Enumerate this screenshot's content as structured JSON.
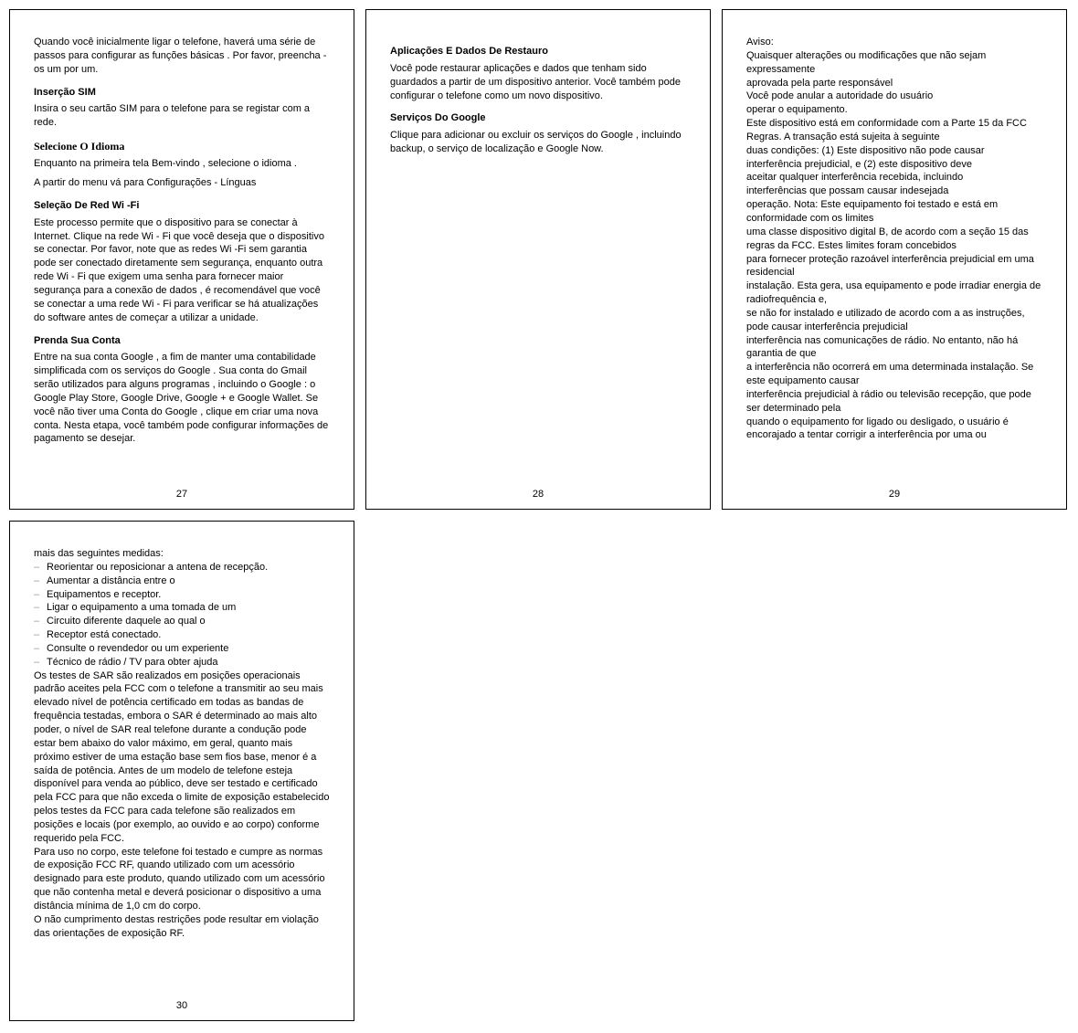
{
  "pages": [
    {
      "number": "27",
      "blocks": [
        {
          "type": "para",
          "text": "Quando você inicialmente ligar o telefone, haverá uma série de passos para configurar as funções básicas . Por favor, preencha -os um por um."
        },
        {
          "type": "heading",
          "text": "Inserção SIM"
        },
        {
          "type": "para",
          "text": "Insira o seu cartão SIM para o telefone para se registar com a rede."
        },
        {
          "type": "heading-serif",
          "text": "Selecione O Idioma"
        },
        {
          "type": "para",
          "text": "Enquanto na primeira tela Bem-vindo , selecione o idioma ."
        },
        {
          "type": "para-tight",
          "text": "A partir do menu vá para Configurações - Línguas"
        },
        {
          "type": "heading",
          "text": "Seleção De Red Wi -Fi"
        },
        {
          "type": "para",
          "text": "Este processo permite que o dispositivo para se conectar à Internet. Clique na rede Wi - Fi que você deseja que o dispositivo se conectar. Por favor, note que as redes Wi -Fi sem garantia pode ser conectado diretamente sem segurança, enquanto outra rede Wi - Fi que exigem uma senha para fornecer maior segurança para a conexão de dados , é recomendável que você se conectar a uma rede Wi - Fi para verificar se há atualizações do software antes de começar a utilizar a unidade."
        },
        {
          "type": "heading",
          "text": "Prenda Sua Conta"
        },
        {
          "type": "para",
          "text": "Entre na sua conta Google , a fim de manter uma contabilidade simplificada com os serviços do Google . Sua conta do Gmail serão utilizados para alguns programas , incluindo o Google : o Google Play Store, Google Drive, Google + e Google Wallet. Se você não tiver uma Conta do Google , clique em criar uma nova conta. Nesta etapa, você também pode configurar informações de pagamento se desejar."
        }
      ]
    },
    {
      "number": "28",
      "blocks": [
        {
          "type": "heading",
          "text": "Aplicações E Dados De Restauro"
        },
        {
          "type": "para",
          "text": "Você pode restaurar aplicações e dados que tenham sido guardados a partir de um dispositivo anterior. Você também pode configurar o telefone como um novo dispositivo."
        },
        {
          "type": "heading",
          "text": "Serviços Do Google"
        },
        {
          "type": "para",
          "text": "Clique para adicionar ou excluir os serviços do Google , incluindo backup, o serviço de localização e Google Now."
        }
      ]
    },
    {
      "number": "29",
      "blocks": [
        {
          "type": "para-tight",
          "text": "Aviso:"
        },
        {
          "type": "para-tight",
          "text": "Quaisquer alterações ou modificações que não sejam expressamente"
        },
        {
          "type": "para-tight",
          "text": "aprovada pela parte responsável"
        },
        {
          "type": "para-tight",
          "text": "Você pode anular a autoridade do usuário"
        },
        {
          "type": "para-tight",
          "text": "operar o equipamento."
        },
        {
          "type": "para-tight",
          "text": "Este dispositivo está em conformidade com a Parte 15 da FCC"
        },
        {
          "type": "para-tight",
          "text": "Regras. A transação está sujeita à seguinte"
        },
        {
          "type": "para-tight",
          "text": "duas condições: (1) Este dispositivo não pode causar"
        },
        {
          "type": "para-tight",
          "text": "interferência prejudicial, e (2) este dispositivo deve"
        },
        {
          "type": "para-tight",
          "text": "aceitar qualquer interferência recebida, incluindo"
        },
        {
          "type": "para-tight",
          "text": "interferências que possam causar indesejada"
        },
        {
          "type": "para-tight",
          "text": "operação. Nota: Este equipamento foi testado e está em conformidade com os limites"
        },
        {
          "type": "para-tight",
          "text": "uma classe dispositivo digital B, de acordo com a seção 15 das regras da FCC. Estes limites foram concebidos"
        },
        {
          "type": "para-tight",
          "text": "para fornecer proteção razoável interferência prejudicial em uma residencial"
        },
        {
          "type": "para-tight",
          "text": "instalação. Esta gera, usa equipamento e pode irradiar energia de radiofrequência e,"
        },
        {
          "type": "para-tight",
          "text": "se não for instalado e utilizado de acordo com a as instruções, pode causar interferência prejudicial"
        },
        {
          "type": "para-tight",
          "text": "interferência nas comunicações de rádio. No entanto, não há garantia de que"
        },
        {
          "type": "para-tight",
          "text": "a interferência não ocorrerá em uma determinada instalação. Se este equipamento causar"
        },
        {
          "type": "para-tight",
          "text": "interferência prejudicial à rádio ou televisão recepção, que pode ser determinado pela"
        },
        {
          "type": "para-tight",
          "text": "quando o equipamento for ligado ou desligado, o usuário é encorajado a tentar corrigir a interferência por uma ou"
        }
      ]
    },
    {
      "number": "30",
      "blocks": [
        {
          "type": "para-tight",
          "text": "mais das seguintes medidas:"
        },
        {
          "type": "bullet",
          "text": "Reorientar ou reposicionar a antena de recepção."
        },
        {
          "type": "bullet",
          "text": "Aumentar a distância entre o"
        },
        {
          "type": "bullet",
          "text": "Equipamentos e receptor."
        },
        {
          "type": "bullet",
          "text": "Ligar o equipamento a uma tomada de um"
        },
        {
          "type": "bullet",
          "text": "Circuito diferente daquele ao qual o"
        },
        {
          "type": "bullet",
          "text": "Receptor está conectado."
        },
        {
          "type": "bullet",
          "text": "Consulte o revendedor ou um experiente"
        },
        {
          "type": "bullet",
          "text": "Técnico de rádio / TV para obter ajuda"
        },
        {
          "type": "para-tight",
          "text": "Os testes de SAR são realizados em posições operacionais padrão aceites pela FCC com o telefone a transmitir ao seu mais elevado nível de potência certificado em todas as bandas de frequência testadas, embora o SAR é determinado ao mais alto poder, o nível de SAR real telefone durante a condução pode estar bem abaixo do valor máximo, em geral, quanto mais próximo estiver de uma estação base sem fios base, menor é a saída de potência. Antes de um modelo de telefone esteja disponível para venda ao público, deve ser testado e certificado pela FCC para que não exceda o limite de exposição estabelecido pelos testes da FCC para cada telefone são realizados em posições e locais (por exemplo, ao ouvido e ao corpo) conforme requerido pela FCC."
        },
        {
          "type": "para-tight",
          "text": "Para uso no corpo, este telefone foi testado e cumpre as normas de exposição FCC RF, quando utilizado com um acessório designado para este produto, quando utilizado com um acessório que não contenha metal e deverá posicionar o dispositivo a uma distância mínima de 1,0 cm do corpo."
        },
        {
          "type": "para-tight",
          "text": "O não cumprimento destas restrições pode resultar em violação das orientações de exposição RF."
        }
      ]
    }
  ]
}
